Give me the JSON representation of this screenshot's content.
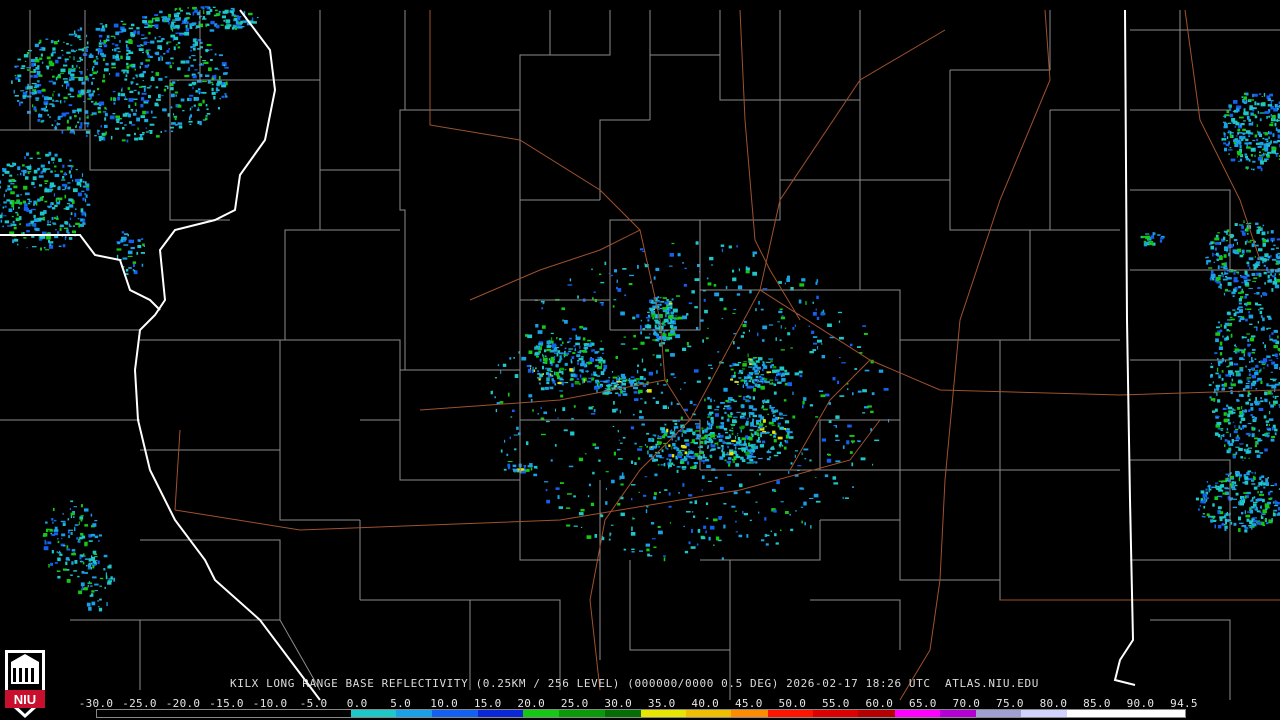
{
  "product": {
    "station": "KILX",
    "caption": "KILX LONG RANGE BASE REFLECTIVITY (0.25KM / 256 LEVEL) (000000/0000 0.5 DEG) 2026-02-17 18:26 UTC  ATLAS.NIU.EDU"
  },
  "scale": {
    "labels": [
      "-30.0",
      "-25.0",
      "-20.0",
      "-15.0",
      "-10.0",
      "-5.0",
      "0.0",
      "5.0",
      "10.0",
      "15.0",
      "20.0",
      "25.0",
      "30.0",
      "35.0",
      "40.0",
      "45.0",
      "50.0",
      "55.0",
      "60.0",
      "65.0",
      "70.0",
      "75.0",
      "80.0",
      "85.0",
      "90.0",
      "94.5"
    ],
    "colors": [
      "#000000",
      "#000000",
      "#000000",
      "#000000",
      "#000000",
      "#000000",
      "#1fc8c8",
      "#1aa0e6",
      "#1460f0",
      "#0a28d8",
      "#14c814",
      "#0a9a0a",
      "#046e04",
      "#e6e600",
      "#f0be00",
      "#ff8c00",
      "#ff1400",
      "#dc0000",
      "#b40000",
      "#ff00ff",
      "#b400d2",
      "#a0a0d2",
      "#d2d2ff",
      "#ffffff",
      "#ffffff",
      "#ffffff"
    ]
  },
  "logo": {
    "text": "NIU",
    "color": "#c8102e"
  },
  "map": {
    "radar_site": "KILX",
    "layers": [
      "state-borders",
      "county-borders",
      "highways",
      "reflectivity"
    ]
  }
}
